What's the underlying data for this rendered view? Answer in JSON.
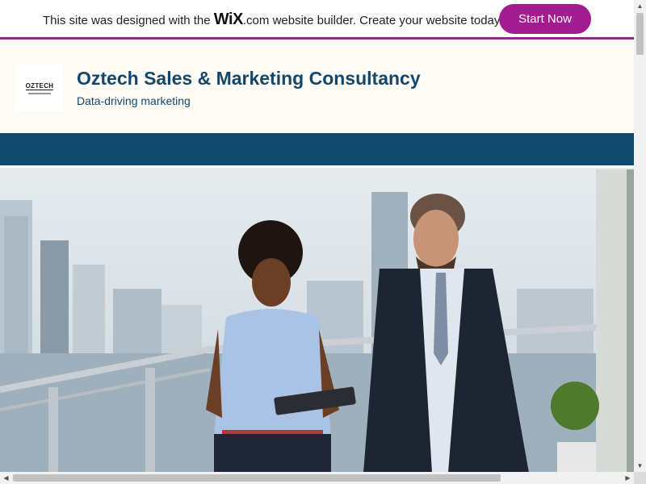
{
  "wix_banner": {
    "text_before": "This site was designed with the ",
    "logo_wix": "WiX",
    "logo_com": ".com",
    "text_after": " website builder. Create your website today.",
    "button_label": "Start Now",
    "accent_color": "#a21c8f"
  },
  "header": {
    "logo_text": "OZTECH",
    "title": "Oztech Sales & Marketing Consultancy",
    "tagline": "Data-driving marketing",
    "title_color": "#15476b"
  },
  "nav": {
    "background_color": "#0f4a6e"
  },
  "hero": {
    "image_description_icon": "photo-two-people-office-balcony"
  },
  "scrollbars": {
    "up_icon": "▲",
    "down_icon": "▼",
    "left_icon": "◀",
    "right_icon": "▶"
  }
}
